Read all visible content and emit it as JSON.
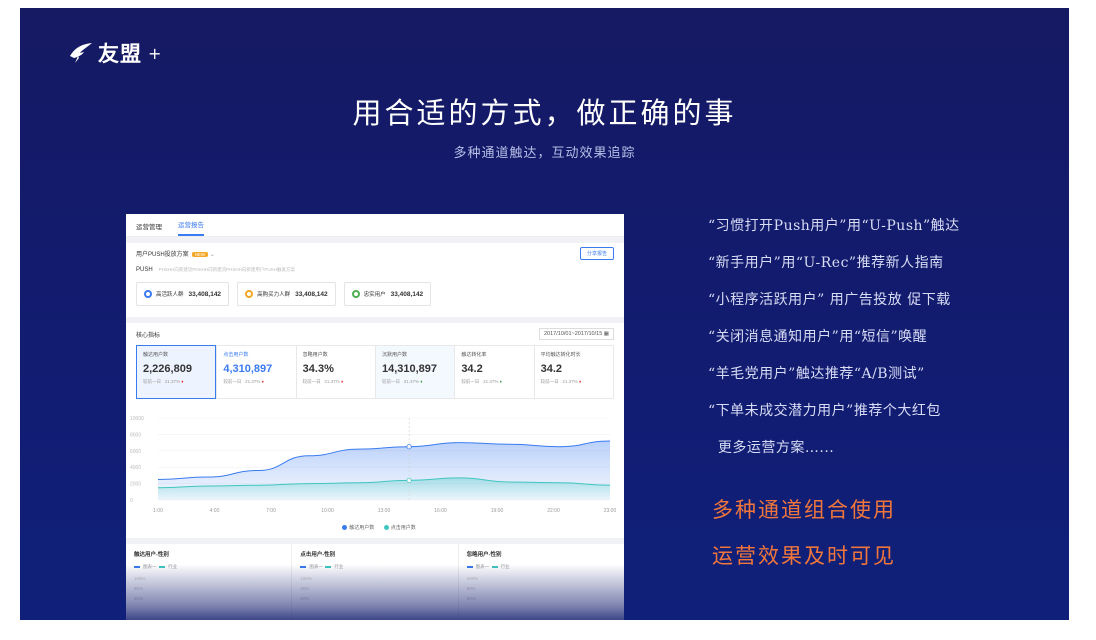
{
  "brand": {
    "name": "友盟",
    "suffix": "+"
  },
  "headline": "用合适的方式，做正确的事",
  "subheadline": "多种通道触达，互动效果追踪",
  "screenshot": {
    "tabs": [
      {
        "label": "运营管理",
        "active": false
      },
      {
        "label": "运营报告",
        "active": true
      }
    ],
    "plan_label": "用户PUSH投放方案",
    "plan_tag": "NEW",
    "share_button": "分享报告",
    "push_label": "PUSH",
    "push_desc": "PHSHH向新建流PHSHH向新建流PHSHH向新建用户PUSH触发方案",
    "crowds": [
      {
        "label": "高活跃人群",
        "value": "33,408,142",
        "color": "#3a7bf0"
      },
      {
        "label": "高购买力人群",
        "value": "33,408,142",
        "color": "#f5a623"
      },
      {
        "label": "忠实用户",
        "value": "33,408,142",
        "color": "#4caf50"
      }
    ],
    "core_title": "核心指标",
    "date_range": "2017/10/01~2017/10/15",
    "metrics": [
      {
        "title": "触达用户数",
        "value": "2,226,809",
        "sub": "较前一日",
        "pct": "21.37%",
        "trend": "down"
      },
      {
        "title": "点击用户数",
        "value": "4,310,897",
        "sub": "较前一日",
        "pct": "21.37%",
        "trend": "down"
      },
      {
        "title": "忽略用户数",
        "value": "34.3%",
        "sub": "较前一日",
        "pct": "21.37%",
        "trend": "down"
      },
      {
        "title": "沉默用户数",
        "value": "14,310,897",
        "sub": "较前一日",
        "pct": "21.37%",
        "trend": "up"
      },
      {
        "title": "触达转化率",
        "value": "34.2",
        "sub": "较前一日",
        "pct": "21.37%",
        "trend": "up"
      },
      {
        "title": "平均触达转化时长",
        "value": "34.2",
        "sub": "较前一日",
        "pct": "21.37%",
        "trend": "down"
      }
    ],
    "legend": [
      {
        "name": "触达用户数",
        "color": "#3a7bf0"
      },
      {
        "name": "点击用户数",
        "color": "#3fc6c0"
      }
    ],
    "bottom_panels": [
      {
        "title": "触达用户-性别",
        "legend_a": "图表一",
        "legend_b": "行业",
        "ticks": [
          "100%",
          "80%",
          "60%"
        ]
      },
      {
        "title": "点击用户-性别",
        "legend_a": "图表一",
        "legend_b": "行业",
        "ticks": [
          "100%",
          "80%",
          "60%"
        ]
      },
      {
        "title": "忽略用户-性别",
        "legend_a": "图表一",
        "legend_b": "行业",
        "ticks": [
          "100%",
          "80%",
          "60%"
        ]
      }
    ]
  },
  "chart_data": {
    "type": "area",
    "x": [
      "1:00",
      "4:00",
      "7:00",
      "10:00",
      "13:00",
      "16:00",
      "19:00",
      "22:00",
      "23:00"
    ],
    "y_ticks": [
      "10000",
      "8000",
      "6000",
      "4000",
      "2000",
      "0"
    ],
    "ylim": [
      0,
      10000
    ],
    "series": [
      {
        "name": "触达用户数",
        "values": [
          2500,
          2800,
          3600,
          5400,
          6200,
          6500,
          7000,
          6800,
          6500,
          7200
        ]
      },
      {
        "name": "点击用户数",
        "values": [
          1500,
          1700,
          1800,
          2000,
          2100,
          2400,
          2700,
          2200,
          2100,
          1800
        ]
      }
    ],
    "grid": true,
    "legend_position": "bottom"
  },
  "right_list": [
    "“习惯打开Push用户”用“U-Push”触达",
    "“新手用户”用“U-Rec”推荐新人指南",
    "“小程序活跃用户” 用广告投放 促下载",
    "“关闭消息通知用户”用“短信”唤醒",
    "“羊毛党用户”触达推荐“A/B测试”",
    "“下单未成交潜力用户”推荐个大红包",
    "  更多运营方案…..."
  ],
  "highlights": [
    "多种通道组合使用",
    "运营效果及时可见"
  ],
  "colors": {
    "accent": "#3a7bf0",
    "highlight": "#f0763b",
    "secondary": "#3fc6c0"
  }
}
